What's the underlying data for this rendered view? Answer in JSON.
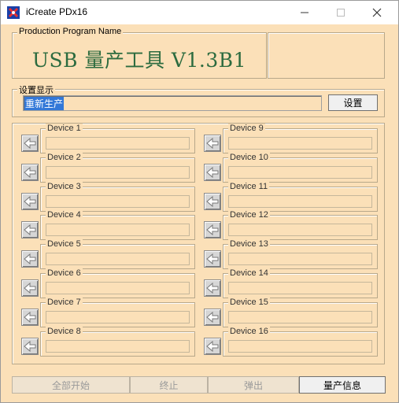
{
  "window": {
    "title": "iCreate PDx16"
  },
  "program": {
    "group_label": "Production Program Name",
    "banner": "USB 量产工具 V1.3B1"
  },
  "settings": {
    "group_label": "设置显示",
    "value": "重新生产",
    "button_label": "设置"
  },
  "devices_left": [
    {
      "label": "Device 1"
    },
    {
      "label": "Device 2"
    },
    {
      "label": "Device 3"
    },
    {
      "label": "Device 4"
    },
    {
      "label": "Device 5"
    },
    {
      "label": "Device 6"
    },
    {
      "label": "Device 7"
    },
    {
      "label": "Device 8"
    }
  ],
  "devices_right": [
    {
      "label": "Device 9"
    },
    {
      "label": "Device 10"
    },
    {
      "label": "Device 11"
    },
    {
      "label": "Device 12"
    },
    {
      "label": "Device 13"
    },
    {
      "label": "Device 14"
    },
    {
      "label": "Device 15"
    },
    {
      "label": "Device 16"
    }
  ],
  "footer": {
    "start_all": "全部开始",
    "stop": "终止",
    "eject": "弹出",
    "production_info": "量产信息"
  },
  "colors": {
    "background": "#fbe0b8",
    "banner_text": "#2c6b3f",
    "selection": "#3378d8"
  },
  "icons": [
    "app-icon",
    "minimize-icon",
    "maximize-icon",
    "close-icon",
    "arrow-left-icon"
  ]
}
